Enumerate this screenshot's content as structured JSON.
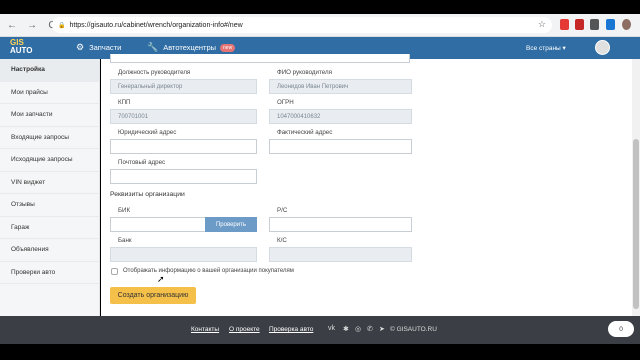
{
  "browser": {
    "url": "https://gisauto.ru/cabinet/wrench/organization-info#/new",
    "back_icon": "←",
    "forward_icon": "→",
    "reload_icon": "C"
  },
  "header": {
    "logo_top": "GIS",
    "logo_bottom": "AUTO",
    "nav_parts": "Запчасти",
    "nav_service": "Автотехцентры",
    "nav_service_badge": "new",
    "countries": "Все страны ▾"
  },
  "sidebar": {
    "items": [
      {
        "label": "Настройка"
      },
      {
        "label": "Мои прайсы"
      },
      {
        "label": "Мои запчасти"
      },
      {
        "label": "Входящие запросы"
      },
      {
        "label": "Исходящие запросы"
      },
      {
        "label": "VIN виджет"
      },
      {
        "label": "Отзывы"
      },
      {
        "label": "Гараж"
      },
      {
        "label": "Объявления"
      },
      {
        "label": "Проверки авто"
      }
    ]
  },
  "form": {
    "head_position_label": "Должность руководителя",
    "head_position_value": "Генеральный директор",
    "head_name_label": "ФИО руководителя",
    "head_name_value": "Леонидов Иван Петрович",
    "kpp_label": "КПП",
    "kpp_value": "700701001",
    "ogrn_label": "ОГРН",
    "ogrn_value": "1047000410632",
    "legal_address_label": "Юридический адрес",
    "actual_address_label": "Фактический адрес",
    "postal_address_label": "Почтовый адрес",
    "bank_section_title": "Реквизиты организации",
    "bik_label": "БИК",
    "check_button": "Проверить",
    "rs_label": "Р/С",
    "bank_label": "Банк",
    "ks_label": "К/С",
    "show_info_checkbox": "Отображать информацию о вашей организации покупателям",
    "create_button": "Создать организацию"
  },
  "footer": {
    "contacts": "Контакты",
    "about": "О проекте",
    "car_check": "Проверка авто",
    "social": [
      "vk",
      "ok",
      "instagram",
      "viber",
      "telegram"
    ],
    "copyright": "© GISAUTO.RU",
    "cart_count": "0"
  },
  "colors": {
    "brand_blue": "#2f6da4",
    "accent_yellow": "#f5c04a",
    "footer": "#3b3f45"
  }
}
